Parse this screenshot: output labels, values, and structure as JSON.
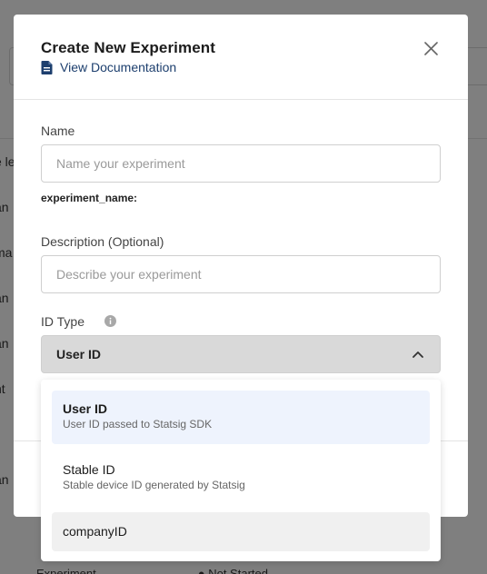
{
  "background": {
    "row_fragments": [
      "e le",
      "an",
      "ma",
      "an",
      "an",
      "nt",
      "an"
    ],
    "footer_left": "Experiment",
    "footer_status": "● Not Started"
  },
  "modal": {
    "title": "Create New Experiment",
    "doc_link": "View Documentation",
    "name": {
      "label": "Name",
      "placeholder": "Name your experiment",
      "value": "",
      "variable_label": "experiment_name:"
    },
    "description": {
      "label": "Description (Optional)",
      "placeholder": "Describe your experiment",
      "value": ""
    },
    "id_type": {
      "label": "ID Type",
      "selected": "User ID"
    }
  },
  "dropdown": {
    "options": [
      {
        "label": "User ID",
        "description": "User ID passed to Statsig SDK"
      },
      {
        "label": "Stable ID",
        "description": "Stable device ID generated by Statsig"
      },
      {
        "label": "companyID",
        "description": ""
      }
    ]
  },
  "colors": {
    "link": "#1d3f6e",
    "selected_option_bg": "#eef3fd",
    "hover_option_bg": "#f0f0f0",
    "select_bg": "#d9d9d9"
  },
  "icons": {
    "doc_link": "document-icon",
    "close": "close-icon",
    "info": "info-icon",
    "select": "chevron-up-icon"
  }
}
